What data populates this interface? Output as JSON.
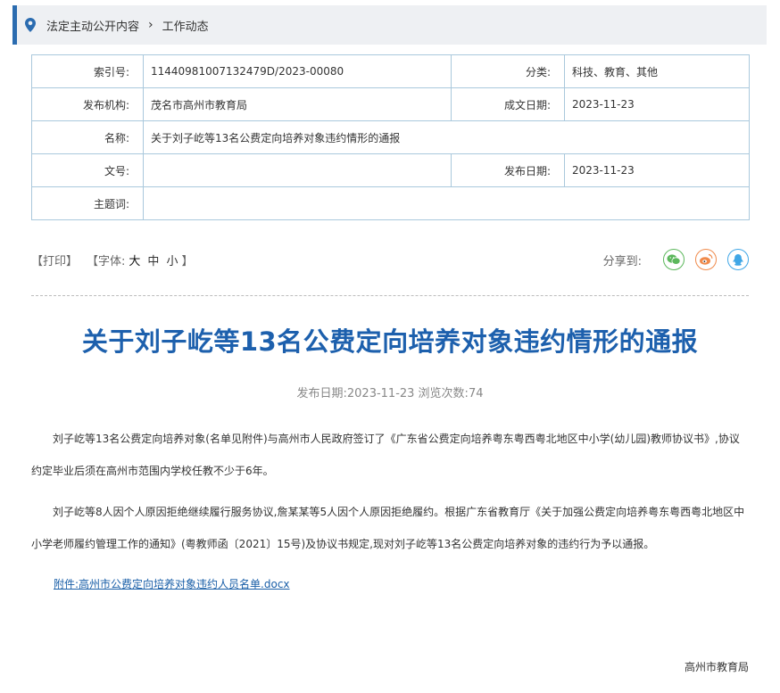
{
  "breadcrumb": {
    "items": [
      "法定主动公开内容",
      "工作动态"
    ]
  },
  "meta": {
    "index_no_label": "索引号:",
    "index_no": "11440981007132479D/2023-00080",
    "category_label": "分类:",
    "category": "科技、教育、其他",
    "publisher_label": "发布机构:",
    "publisher": "茂名市高州市教育局",
    "created_date_label": "成文日期:",
    "created_date": "2023-11-23",
    "name_label": "名称:",
    "name": "关于刘子屹等13名公费定向培养对象违约情形的通报",
    "doc_no_label": "文号:",
    "doc_no": "",
    "publish_date_label": "发布日期:",
    "publish_date": "2023-11-23",
    "keywords_label": "主题词:",
    "keywords": ""
  },
  "tools": {
    "print": "【打印】",
    "font_open": "【字体:",
    "font_big": "大",
    "font_mid": "中",
    "font_small": "小",
    "font_close": "】",
    "share_label": "分享到:"
  },
  "article": {
    "title": "关于刘子屹等13名公费定向培养对象违约情形的通报",
    "info": "发布日期:2023-11-23 浏览次数:74",
    "paragraph1": "刘子屹等13名公费定向培养对象(名单见附件)与高州市人民政府签订了《广东省公费定向培养粤东粤西粤北地区中小学(幼儿园)教师协议书》,协议约定毕业后须在高州市范围内学校任教不少于6年。",
    "paragraph2": "刘子屹等8人因个人原因拒绝继续履行服务协议,詹某某等5人因个人原因拒绝履约。根据广东省教育厅《关于加强公费定向培养粤东粤西粤北地区中小学老师履约管理工作的通知》(粤教师函〔2021〕15号)及协议书规定,现对刘子屹等13名公费定向培养对象的违约行为予以通报。",
    "attachment": "附件:高州市公费定向培养对象违约人员名单.docx",
    "signature": "高州市教育局"
  },
  "colors": {
    "accent": "#2b6cb0",
    "title": "#1d60ad",
    "table_border": "#aac8dc",
    "wechat": "#5bb75b",
    "weibo": "#f08a4b",
    "qq": "#3fa6e6"
  },
  "icons": [
    "location-pin-icon",
    "chevron-right-icon",
    "wechat-icon",
    "weibo-icon",
    "qq-icon"
  ]
}
